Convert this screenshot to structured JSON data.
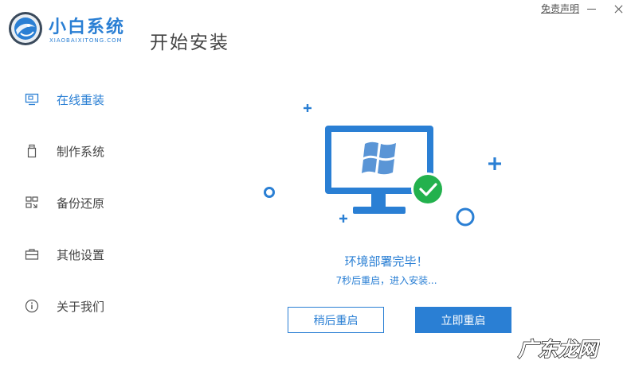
{
  "app": {
    "brand_name": "小白系统",
    "brand_domain": "XIAOBAIXITONG.COM",
    "page_title": "开始安装",
    "disclaimer_label": "免责声明"
  },
  "sidebar": {
    "items": [
      {
        "label": "在线重装",
        "icon": "monitor-icon",
        "active": true
      },
      {
        "label": "制作系统",
        "icon": "usb-drive-icon",
        "active": false
      },
      {
        "label": "备份还原",
        "icon": "grid-restore-icon",
        "active": false
      },
      {
        "label": "其他设置",
        "icon": "toolbox-icon",
        "active": false
      },
      {
        "label": "关于我们",
        "icon": "info-icon",
        "active": false
      }
    ]
  },
  "main": {
    "status_title": "环境部署完毕！",
    "status_subtitle": "7秒后重启，进入安装...",
    "restart_later_label": "稍后重启",
    "restart_now_label": "立即重启"
  },
  "watermark": {
    "text": "广东龙网"
  },
  "colors": {
    "accent": "#2a7fd4",
    "success": "#23b14d",
    "text": "#444444"
  }
}
